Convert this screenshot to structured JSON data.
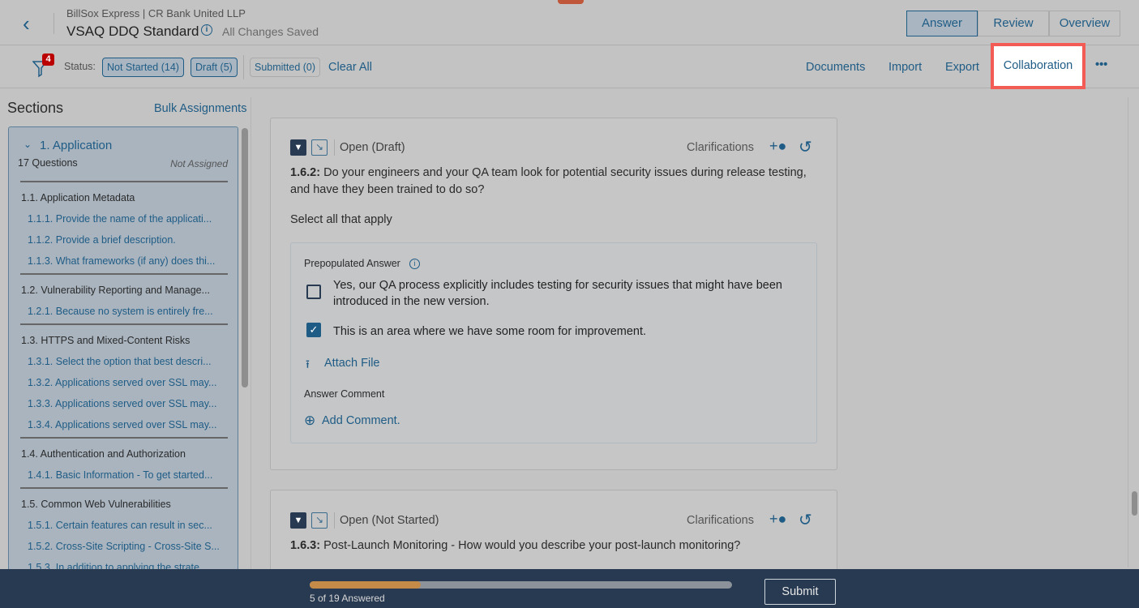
{
  "header": {
    "org": "BillSox Express | CR Bank United LLP",
    "title": "VSAQ DDQ Standard",
    "saved": "All Changes Saved",
    "modes": [
      "Answer",
      "Review",
      "Overview"
    ]
  },
  "toolbar": {
    "filter_count": "4",
    "status_label": "Status:",
    "chips": [
      "Not Started (14)",
      "Draft (5)",
      "Submitted (0)"
    ],
    "clear_all": "Clear All",
    "links": [
      "Documents",
      "Import",
      "Export",
      "Collaboration"
    ],
    "more": "•••"
  },
  "sidebar": {
    "title": "Sections",
    "bulk": "Bulk Assignments",
    "section": {
      "name": "1. Application",
      "count": "17 Questions",
      "assign": "Not Assigned"
    },
    "groups": [
      {
        "title": "1.1. Application Metadata",
        "items": [
          "1.1.1. Provide the name of the applicati...",
          "1.1.2. Provide a brief description.",
          "1.1.3. What frameworks (if any) does thi..."
        ]
      },
      {
        "title": "1.2. Vulnerability Reporting and Manage...",
        "items": [
          "1.2.1. Because no system is entirely fre..."
        ]
      },
      {
        "title": "1.3. HTTPS and Mixed-Content Risks",
        "items": [
          "1.3.1. Select the option that best descri...",
          "1.3.2. Applications served over SSL may...",
          "1.3.3. Applications served over SSL may...",
          "1.3.4. Applications served over SSL may..."
        ]
      },
      {
        "title": "1.4. Authentication and Authorization",
        "items": [
          "1.4.1. Basic Information - To get started..."
        ]
      },
      {
        "title": "1.5. Common Web Vulnerabilities",
        "items": [
          "1.5.1. Certain features can result in sec...",
          "1.5.2. Cross-Site Scripting - Cross-Site S...",
          "1.5.3. In addition to applying the strate..."
        ]
      }
    ]
  },
  "questions": [
    {
      "state": "Open (Draft)",
      "clarifications": "Clarifications",
      "number": "1.6.2:",
      "text": " Do your engineers and your QA team look for potential security issues during release testing, and have they been trained to do so?",
      "instruction": "Select all that apply",
      "prepopulated": "Prepopulated Answer",
      "options": [
        {
          "label": "Yes, our QA process explicitly includes testing for security issues that might have been introduced in the new version.",
          "checked": false
        },
        {
          "label": "This is an area where we have some room for improvement.",
          "checked": true
        }
      ],
      "attach": "Attach File",
      "comment_label": "Answer Comment",
      "add_comment": "Add Comment."
    },
    {
      "state": "Open (Not Started)",
      "clarifications": "Clarifications",
      "number": "1.6.3:",
      "text": " Post-Launch Monitoring - How would you describe your post-launch monitoring?"
    }
  ],
  "footer": {
    "answered": "5 of 19 Answered",
    "progress_fraction": 0.263,
    "submit": "Submit"
  },
  "colors": {
    "accent": "#1f5c85",
    "highlight": "#f25c54",
    "footer": "#283a52",
    "progress": "#c38a48"
  }
}
